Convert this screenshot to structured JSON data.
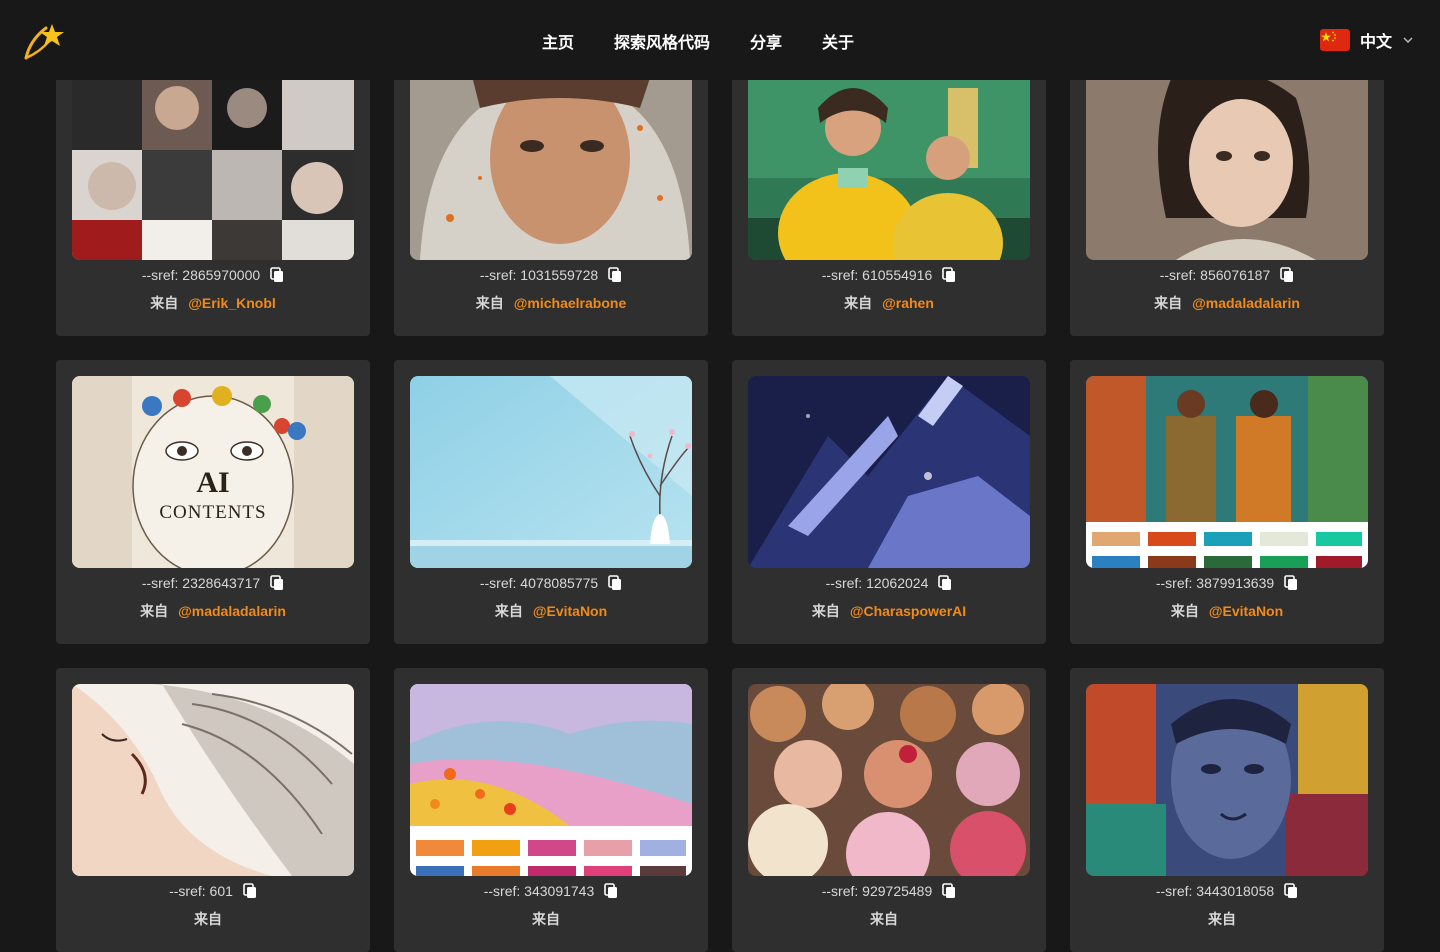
{
  "brand": {
    "logo_icon": "shooting-star-logo-icon",
    "accent_color": "#f08a1c"
  },
  "nav": {
    "items": [
      "主页",
      "探索风格代码",
      "分享",
      "关于"
    ]
  },
  "language": {
    "label": "中文",
    "flag_icon": "china-flag-icon",
    "chevron_icon": "chevron-down-icon"
  },
  "card_labels": {
    "from": "来自",
    "copy_icon": "copy-icon"
  },
  "cards": [
    {
      "sref": "--sref: 2865970000",
      "author": "@Erik_Knobl"
    },
    {
      "sref": "--sref: 1031559728",
      "author": "@michaelrabone"
    },
    {
      "sref": "--sref: 610554916",
      "author": "@rahen"
    },
    {
      "sref": "--sref: 856076187",
      "author": "@madaladalarin"
    },
    {
      "sref": "--sref: 2328643717",
      "author": "@madaladalarin"
    },
    {
      "sref": "--sref: 4078085775",
      "author": "@EvitaNon"
    },
    {
      "sref": "--sref: 12062024",
      "author": "@CharaspowerAI"
    },
    {
      "sref": "--sref: 3879913639",
      "author": "@EvitaNon"
    },
    {
      "sref": "--sref: 601",
      "author": ""
    },
    {
      "sref": "--sref: 343091743",
      "author": ""
    },
    {
      "sref": "--sref: 929725489",
      "author": ""
    },
    {
      "sref": "--sref: 3443018058",
      "author": ""
    }
  ],
  "image_texts": {
    "ai_title": "AI",
    "ai_subtitle": "CONTENTS"
  }
}
